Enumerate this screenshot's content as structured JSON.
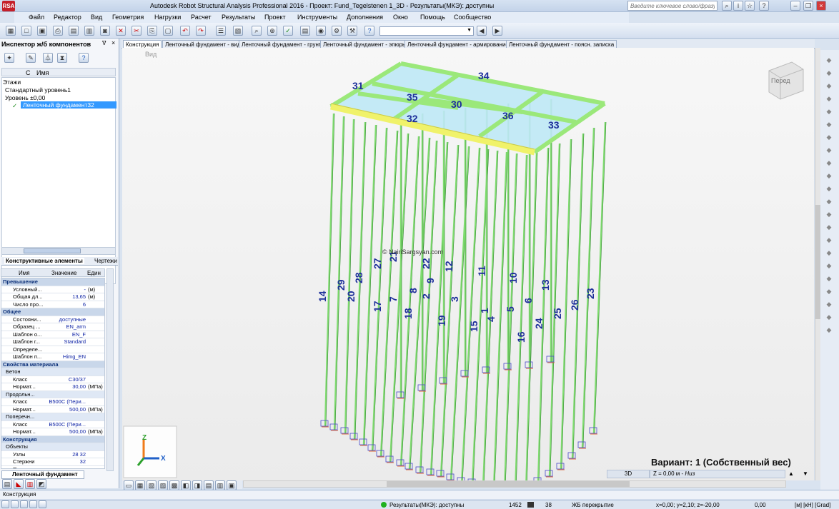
{
  "window": {
    "title": "Autodesk Robot Structural Analysis Professional 2016 - Проект: Fund_Tegelstenen 1_3D - Результаты(МКЭ): доступны",
    "app_icon": "RSA"
  },
  "search": {
    "placeholder": "Введите ключевое слово/фразу"
  },
  "menu": [
    "Файл",
    "Редактор",
    "Вид",
    "Геометрия",
    "Нагрузки",
    "Расчет",
    "Результаты",
    "Проект",
    "Инструменты",
    "Дополнения",
    "Окно",
    "Помощь",
    "Сообщество"
  ],
  "inspector": {
    "title": "Инспектор ж/б компонентов",
    "columns": {
      "c": "С",
      "name": "Имя"
    },
    "tree": {
      "root": "Этажи",
      "level_std": "Стандартный уровень1",
      "level0": "Уровень ±0,00",
      "selected": "Ленточный фундамент32"
    },
    "tabs": {
      "elements": "Конструктивные элементы",
      "drawings": "Чертежи"
    }
  },
  "properties": {
    "headers": {
      "name": "Имя",
      "value": "Значение",
      "unit": "Един"
    },
    "rows": [
      {
        "type": "grp",
        "name": "Превышение"
      },
      {
        "type": "row",
        "name": "Условный...",
        "value": "-",
        "unit": "(м)"
      },
      {
        "type": "row",
        "name": "Общая дл...",
        "value": "13,65",
        "unit": "(м)"
      },
      {
        "type": "row",
        "name": "Число про...",
        "value": "6",
        "unit": ""
      },
      {
        "type": "grp",
        "name": "Общее"
      },
      {
        "type": "row",
        "name": "Состояни...",
        "value": "доступные",
        "unit": ""
      },
      {
        "type": "row",
        "name": "Образец ...",
        "value": "EN_arm",
        "unit": ""
      },
      {
        "type": "row",
        "name": "Шаблон о...",
        "value": "EN_F",
        "unit": ""
      },
      {
        "type": "row",
        "name": "Шаблон г...",
        "value": "Standard",
        "unit": ""
      },
      {
        "type": "row",
        "name": "Определе...",
        "value": "",
        "unit": ""
      },
      {
        "type": "row",
        "name": "Шаблон п...",
        "value": "Himg_EN",
        "unit": ""
      },
      {
        "type": "grp",
        "name": "Свойства материала"
      },
      {
        "type": "sub",
        "name": "Бетон"
      },
      {
        "type": "row",
        "name": "Класс",
        "value": "C30/37",
        "unit": ""
      },
      {
        "type": "row",
        "name": "Нормат...",
        "value": "30,00",
        "unit": "(МПа)"
      },
      {
        "type": "sub",
        "name": "Продольн..."
      },
      {
        "type": "row",
        "name": "Класс",
        "value": "B500C (Пери...",
        "unit": ""
      },
      {
        "type": "row",
        "name": "Нормат...",
        "value": "500,00",
        "unit": "(МПа)"
      },
      {
        "type": "sub",
        "name": "Поперечн..."
      },
      {
        "type": "row",
        "name": "Класс",
        "value": "B500C (Пери...",
        "unit": ""
      },
      {
        "type": "row",
        "name": "Нормат...",
        "value": "500,00",
        "unit": "(МПа)"
      },
      {
        "type": "grp",
        "name": "Конструкция"
      },
      {
        "type": "sub",
        "name": "Объекты"
      },
      {
        "type": "row",
        "name": "Узлы",
        "value": "28 32",
        "unit": ""
      },
      {
        "type": "row",
        "name": "Стержни",
        "value": "32",
        "unit": ""
      },
      {
        "type": "row",
        "name": "Панели",
        "value": "",
        "unit": ""
      }
    ],
    "bottom_tab": "Ленточный фундамент"
  },
  "tabs": [
    "Конструкция",
    "Ленточный фундамент - вид",
    "Ленточный фундамент - грунт",
    "Ленточный фундамент - эпюры",
    "Ленточный фундамент - армирование",
    "Ленточный фундамент - поясн. записка"
  ],
  "viewport": {
    "view_label": "Вид",
    "watermark": "© NairiSargsyan.com",
    "viewcube": "Перед",
    "variant": "Вариант: 1 (Собственный вес)",
    "mode": "3D",
    "z_level": "Z = 0,00 м",
    "z_suffix": "Низ",
    "axes": {
      "x": "X",
      "z": "Z"
    },
    "beam_labels": [
      "31",
      "34",
      "35",
      "30",
      "32",
      "36",
      "33"
    ],
    "pile_labels": [
      "14",
      "29",
      "20",
      "28",
      "17",
      "27",
      "21",
      "7",
      "18",
      "8",
      "2",
      "22",
      "9",
      "19",
      "3",
      "12",
      "15",
      "11",
      "1",
      "4",
      "10",
      "5",
      "16",
      "6",
      "24",
      "13",
      "25",
      "26",
      "23"
    ]
  },
  "cmdline": "Конструкция",
  "status": {
    "results": "Результаты(МКЭ): доступны",
    "nodes": "1452",
    "bars": "38",
    "slab": "ЖБ перекрытие",
    "coords": "x=0,00; y=2,10; z=-20,00",
    "angle": "0,00",
    "units": "[м] [кН] [Grad]"
  },
  "colors": {
    "beam": "#9be87a",
    "pile": "#7fdc6f",
    "slab": "#bfe9f7",
    "selected": "#f0f26a",
    "label": "#1d2f9a"
  }
}
